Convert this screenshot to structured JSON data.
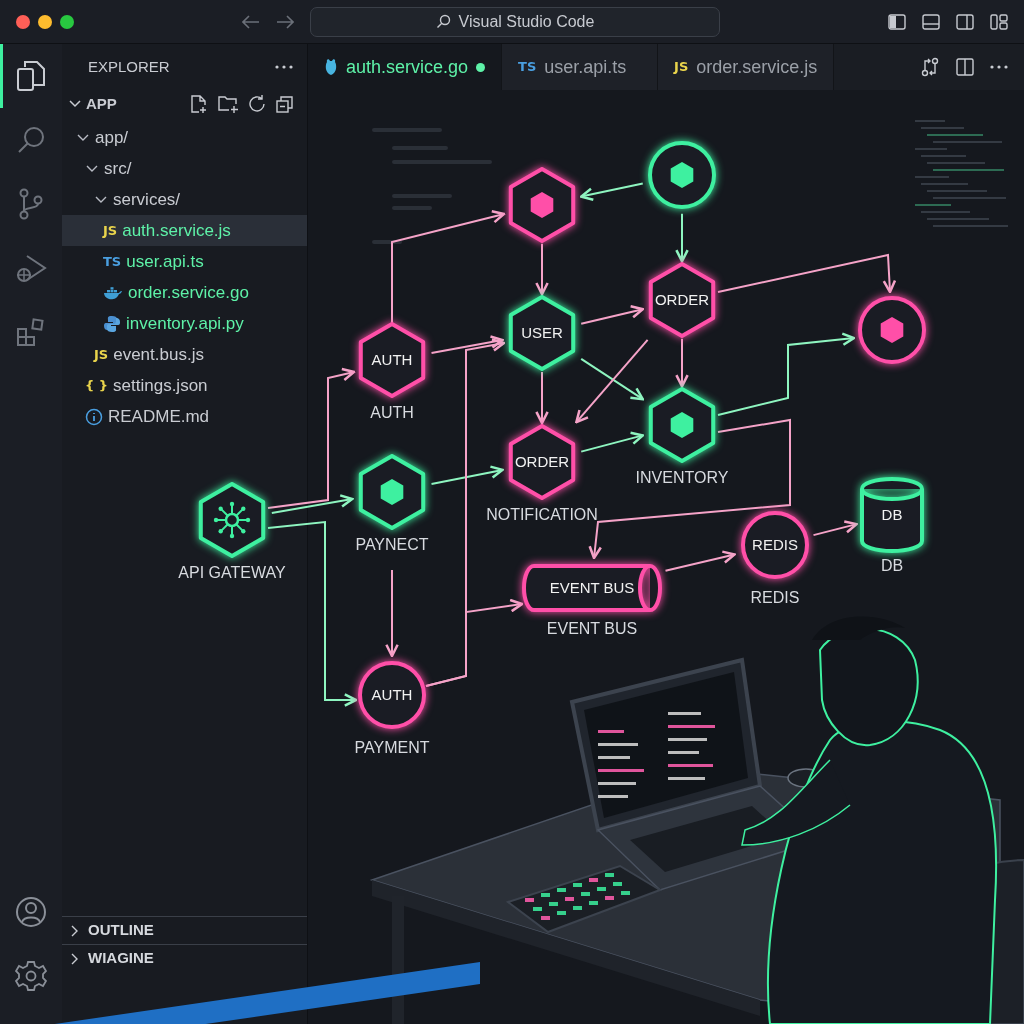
{
  "window": {
    "title": "Visual Studio Code"
  },
  "tabs": [
    {
      "label": "auth.service.go",
      "kind": "go",
      "selected": true,
      "modified": true
    },
    {
      "label": "user.api.ts",
      "kind": "badge",
      "badge": "TS",
      "color": "#4a9fe0",
      "selected": false,
      "modified": false
    },
    {
      "label": "order.service.js",
      "kind": "badge",
      "badge": "JS",
      "color": "#e9d44c",
      "selected": false,
      "modified": false
    }
  ],
  "sidebar": {
    "title": "EXPLORER",
    "root": "APP",
    "tree": [
      {
        "label": "app/",
        "expanded": true,
        "children": [
          {
            "label": "src/",
            "expanded": true,
            "children": [
              {
                "label": "services/",
                "expanded": true,
                "children": [
                  {
                    "label": "auth.service.js",
                    "kind": "badge",
                    "badge": "JS",
                    "color": "#e9d44c",
                    "selected": true,
                    "modified": true
                  },
                  {
                    "label": "user.api.ts",
                    "kind": "badge",
                    "badge": "TS",
                    "color": "#4a9fe0",
                    "selected": false,
                    "modified": true
                  },
                  {
                    "label": "order.service.go",
                    "kind": "docker",
                    "selected": false,
                    "modified": true
                  },
                  {
                    "label": "inventory.api.py",
                    "kind": "python",
                    "selected": false,
                    "modified": true
                  }
                ]
              },
              {
                "label": "event.bus.js",
                "kind": "badge",
                "badge": "JS",
                "color": "#e9d44c",
                "selected": false,
                "modified": false
              }
            ]
          },
          {
            "label": "settings.json",
            "kind": "badge",
            "badge": "{ }",
            "color": "#e9d44c",
            "selected": false,
            "modified": false
          },
          {
            "label": "README.md",
            "kind": "info",
            "selected": false,
            "modified": false
          }
        ]
      }
    ],
    "sections": [
      {
        "label": "OUTLINE",
        "expanded": false
      },
      {
        "label": "WIAGINE",
        "expanded": false
      }
    ]
  },
  "diagram": {
    "nodes": [
      {
        "kind": "hexagon_core",
        "color": "#ff4fa8"
      },
      {
        "kind": "circle_core",
        "color": "#3ef0a0"
      },
      {
        "kind": "hexagon",
        "color": "#ff4fa8",
        "label": "AUTH",
        "caption": "AUTH"
      },
      {
        "kind": "hexagon",
        "color": "#3ef0a0",
        "label": "USER"
      },
      {
        "kind": "hexagon",
        "color": "#ff4fa8",
        "label": "ORDER"
      },
      {
        "kind": "circle_core",
        "color": "#ff4fa8"
      },
      {
        "kind": "hexagon",
        "color": "#ff4fa8",
        "label": "ORDER",
        "caption": "NOTIFICATION"
      },
      {
        "kind": "hexagon_core",
        "color": "#3ef0a0",
        "caption": "INVENTORY"
      },
      {
        "kind": "hub",
        "color": "#3ef0a0",
        "caption": "API GATEWAY"
      },
      {
        "kind": "hexagon_core",
        "color": "#3ef0a0",
        "caption": "PAYNECT"
      },
      {
        "kind": "tube",
        "color": "#ff4fa8",
        "label": "EVENT BUS",
        "caption": "EVENT BUS"
      },
      {
        "kind": "circle",
        "color": "#ff4fa8",
        "label": "REDIS",
        "caption": "REDIS"
      },
      {
        "kind": "drum",
        "color": "#3ef0a0",
        "label": "DB",
        "caption": "DB"
      },
      {
        "kind": "circle",
        "color": "#ff4fa8",
        "label": "AUTH",
        "caption": "PAYMENT"
      }
    ]
  }
}
